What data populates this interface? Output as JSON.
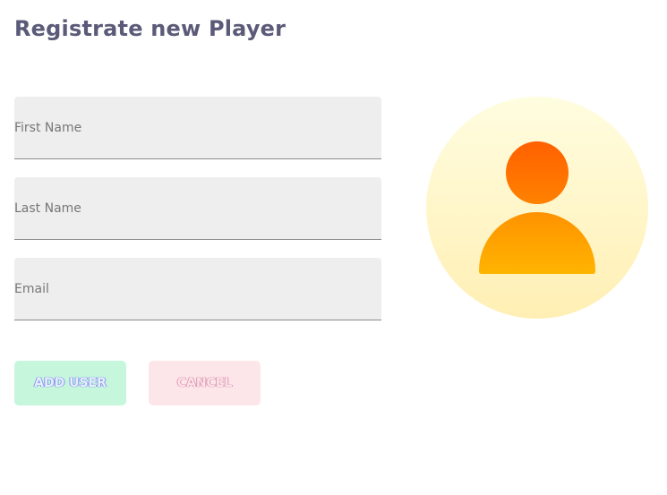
{
  "header": {
    "title": "Registrate new Player"
  },
  "form": {
    "first_name": {
      "placeholder": "First Name",
      "value": ""
    },
    "last_name": {
      "placeholder": "Last Name",
      "value": ""
    },
    "email": {
      "placeholder": "Email",
      "value": ""
    }
  },
  "actions": {
    "add_label": "ADD USER",
    "cancel_label": "CANCEL"
  },
  "avatar": {
    "icon": "user-avatar-icon"
  },
  "colors": {
    "title": "#5b5a78",
    "field_bg": "#eeeeee",
    "add_button_bg": "#c6f7dc",
    "cancel_button_bg": "#fde6ea",
    "avatar_head_top": "#ff6a00",
    "avatar_body_bottom": "#ffb000",
    "avatar_circle": "#fff6c8"
  }
}
